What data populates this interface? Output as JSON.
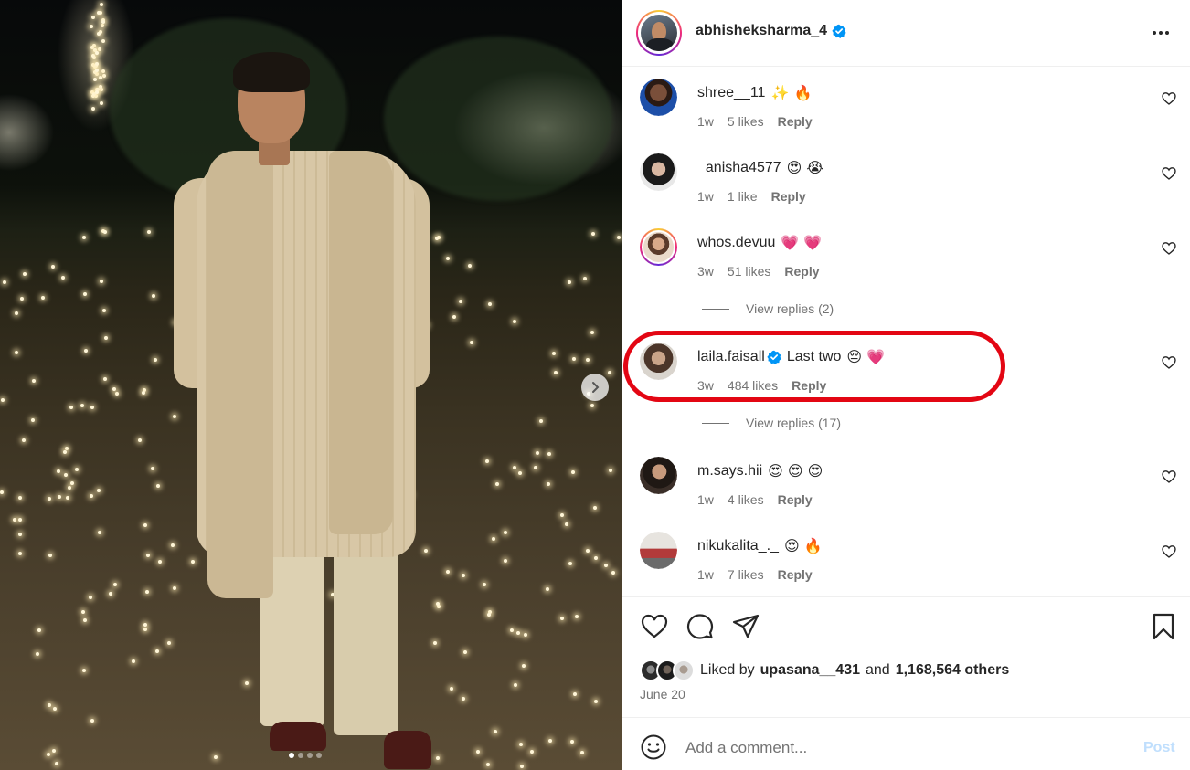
{
  "post": {
    "author": "abhisheksharma_4",
    "verified": true,
    "carousel_dots": 4,
    "active_dot": 0
  },
  "comments": [
    {
      "user": "shree__11",
      "text": "",
      "emojis": "✨ 🔥",
      "time": "1w",
      "likes": "5 likes",
      "reply": "Reply"
    },
    {
      "user": "_anisha4577",
      "text": "",
      "emojis": "😍 😭",
      "time": "1w",
      "likes": "1 like",
      "reply": "Reply"
    },
    {
      "user": "whos.devuu",
      "text": "",
      "emojis": "💗 💗",
      "time": "3w",
      "likes": "51 likes",
      "reply": "Reply",
      "view_replies": "View replies (2)"
    },
    {
      "user": "laila.faisall",
      "verified": true,
      "text": "Last two",
      "emojis": "😔 💗",
      "time": "3w",
      "likes": "484 likes",
      "reply": "Reply",
      "view_replies": "View replies (17)",
      "highlighted": true
    },
    {
      "user": "m.says.hii",
      "text": "",
      "emojis": "😍 😍 😍",
      "time": "1w",
      "likes": "4 likes",
      "reply": "Reply"
    },
    {
      "user": "nikukalita_._",
      "text": "",
      "emojis": "😍 🔥",
      "time": "1w",
      "likes": "7 likes",
      "reply": "Reply"
    }
  ],
  "likes": {
    "prefix": "Liked by",
    "user": "upasana__431",
    "conj": "and",
    "others": "1,168,564 others"
  },
  "date": "June 20",
  "add_comment": {
    "placeholder": "Add a comment...",
    "post_label": "Post"
  },
  "icons": {
    "like": "heart-icon",
    "comment": "comment-icon",
    "share": "share-icon",
    "save": "bookmark-icon",
    "emoji": "smile-icon",
    "more": "more-icon",
    "next": "chevron-right-icon"
  },
  "colors": {
    "highlight": "#e30613",
    "verified": "#0095f6",
    "post_disabled": "#c0dffd",
    "muted": "#737373"
  }
}
